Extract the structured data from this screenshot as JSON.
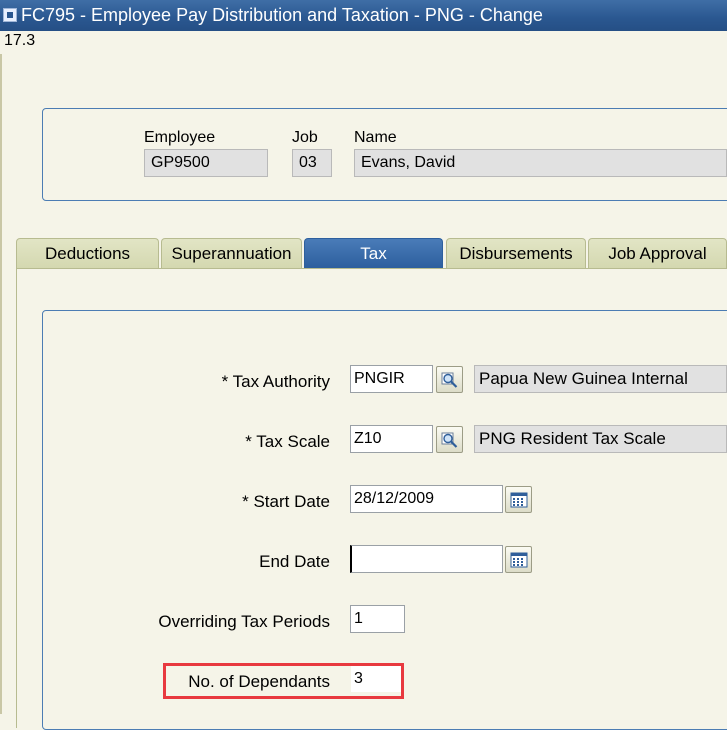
{
  "window": {
    "title": "FC795 - Employee Pay Distribution and Taxation - PNG - Change",
    "version": "17.3"
  },
  "header": {
    "employee_label": "Employee",
    "employee_value": "GP9500",
    "job_label": "Job",
    "job_value": "03",
    "name_label": "Name",
    "name_value": "Evans, David"
  },
  "tabs": [
    {
      "label": "Deductions",
      "active": false
    },
    {
      "label": "Superannuation",
      "active": false
    },
    {
      "label": "Tax",
      "active": true
    },
    {
      "label": "Disbursements",
      "active": false
    },
    {
      "label": "Job Approval",
      "active": false
    }
  ],
  "tax": {
    "tax_authority_label": "* Tax Authority",
    "tax_authority_value": "PNGIR",
    "tax_authority_desc": "Papua New Guinea Internal",
    "tax_scale_label": "* Tax Scale",
    "tax_scale_value": "Z10",
    "tax_scale_desc": "PNG Resident Tax Scale",
    "start_date_label": "* Start Date",
    "start_date_value": "28/12/2009",
    "end_date_label": "End Date",
    "end_date_value": "",
    "overriding_periods_label": "Overriding Tax Periods",
    "overriding_periods_value": "1",
    "dependants_label": "No. of Dependants",
    "dependants_value": "3"
  },
  "icons": {
    "lookup": "magnifier-icon",
    "calendar": "calendar-icon"
  },
  "colors": {
    "title_bar": "#2a5790",
    "active_tab": "#3a6eaa",
    "background": "#f5f4e8",
    "highlight": "#e8393f"
  }
}
